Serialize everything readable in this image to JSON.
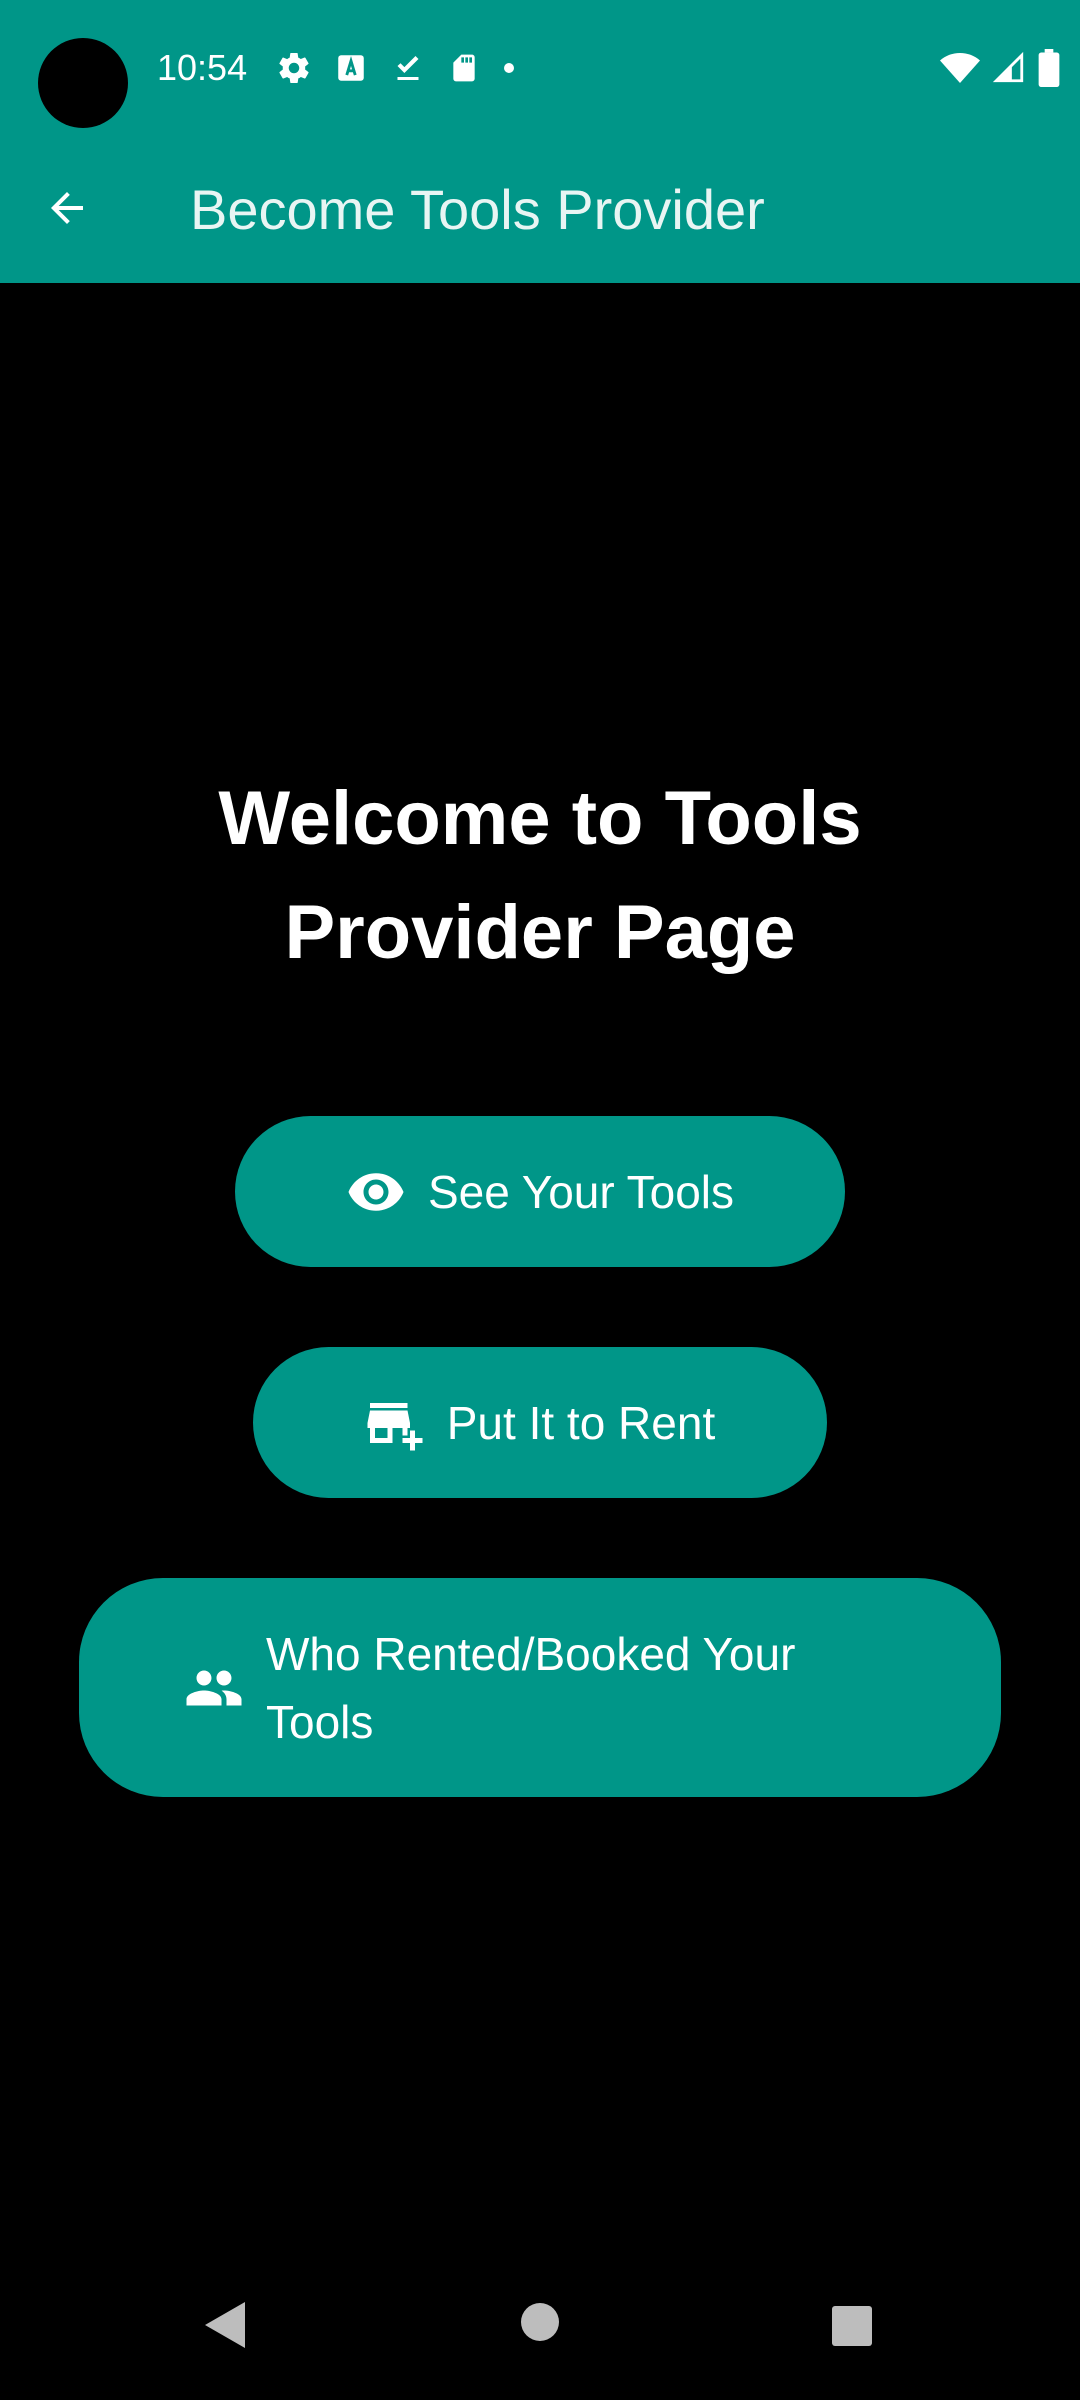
{
  "status_bar": {
    "time": "10:54",
    "icons_left": [
      "settings-icon",
      "font-a-icon",
      "download-done-icon",
      "sd-card-icon",
      "notification-dot-icon"
    ],
    "icons_right": [
      "wifi-icon",
      "cellular-signal-icon",
      "battery-icon"
    ]
  },
  "app_bar": {
    "title": "Become Tools Provider",
    "back_icon": "arrow-back-icon",
    "background_color": "#009688"
  },
  "main": {
    "welcome_title": "Welcome to Tools Provider Page",
    "buttons": [
      {
        "label": "See Your Tools",
        "icon": "eye-icon"
      },
      {
        "label": "Put It to Rent",
        "icon": "storefront-add-icon"
      },
      {
        "label": "Who Rented/Booked Your Tools",
        "icon": "people-icon"
      }
    ],
    "button_color": "#009688"
  },
  "nav_bar": {
    "icons": [
      "nav-back-icon",
      "nav-home-icon",
      "nav-recents-icon"
    ]
  }
}
